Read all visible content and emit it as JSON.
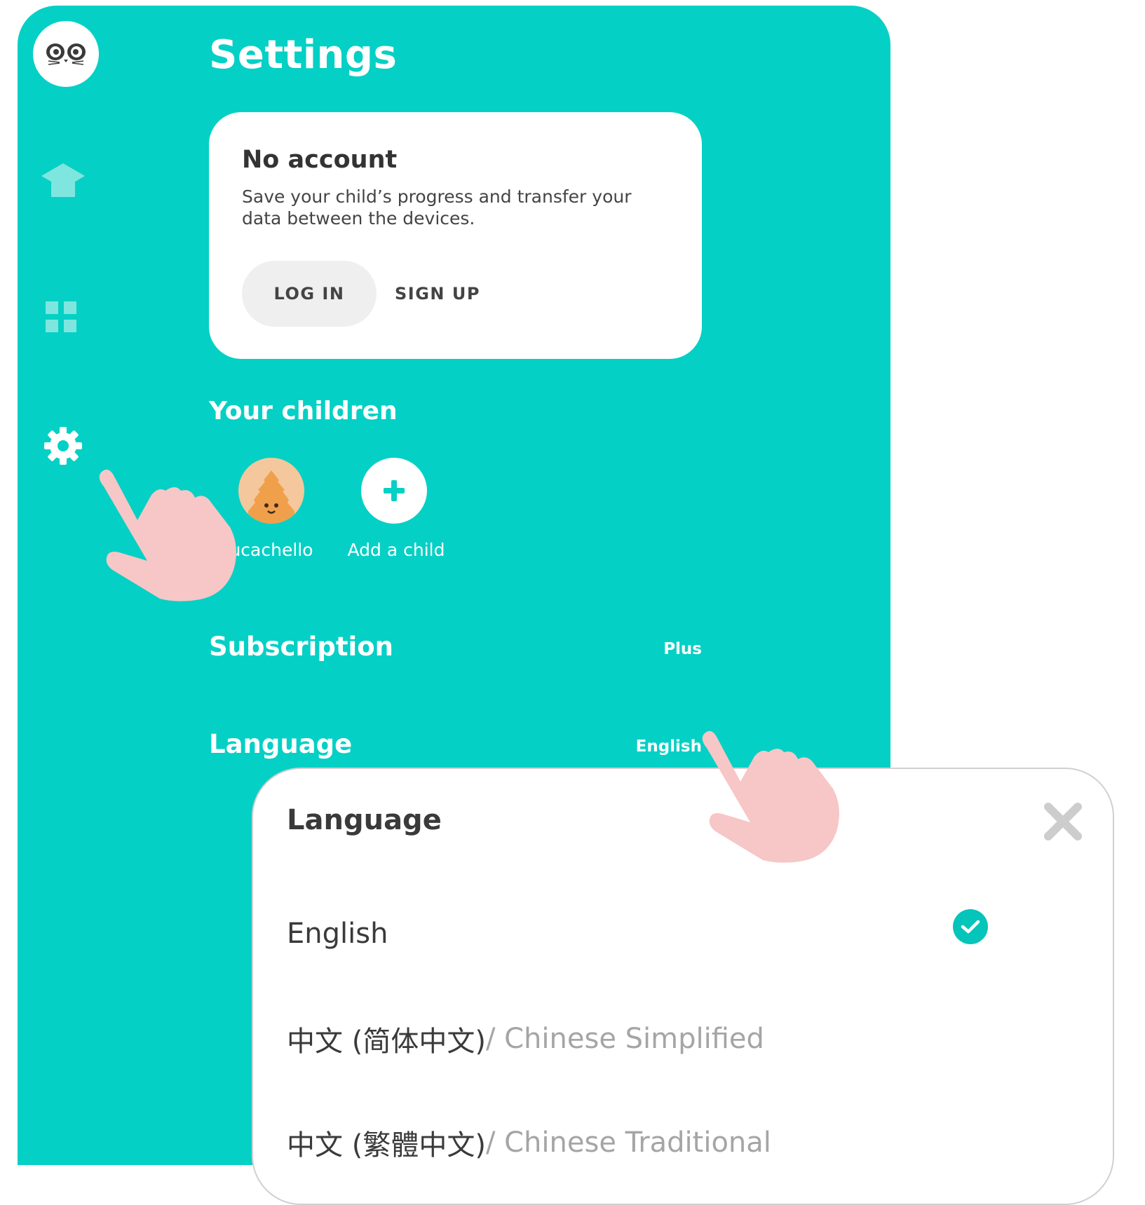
{
  "page": {
    "title": "Settings"
  },
  "account": {
    "title": "No account",
    "description": "Save your child’s progress and transfer your data between the devices.",
    "login_label": "LOG IN",
    "signup_label": "SIGN UP"
  },
  "children": {
    "section_title": "Your children",
    "items": [
      {
        "name": "ucachello"
      }
    ],
    "add_label": "Add a child"
  },
  "subscription": {
    "label": "Subscription",
    "value": "Plus"
  },
  "language": {
    "label": "Language",
    "value": "English"
  },
  "language_modal": {
    "title": "Language",
    "options": [
      {
        "native": "English",
        "english": "",
        "selected": true
      },
      {
        "native": "中文 (简体中文)",
        "english": " / Chinese Simplified",
        "selected": false
      },
      {
        "native": "中文 (繁體中文)",
        "english": " / Chinese Traditional",
        "selected": false
      }
    ]
  },
  "icons": {
    "logo": "panda-logo-icon",
    "nav": [
      "graduation-cap-icon",
      "grid-icon",
      "gear-icon"
    ],
    "close": "close-icon",
    "check": "check-icon",
    "pointer": "pointing-hand-icon"
  },
  "colors": {
    "brand": "#05d0c5",
    "accent": "#05c4ba",
    "hand": "#f7c6c6"
  }
}
